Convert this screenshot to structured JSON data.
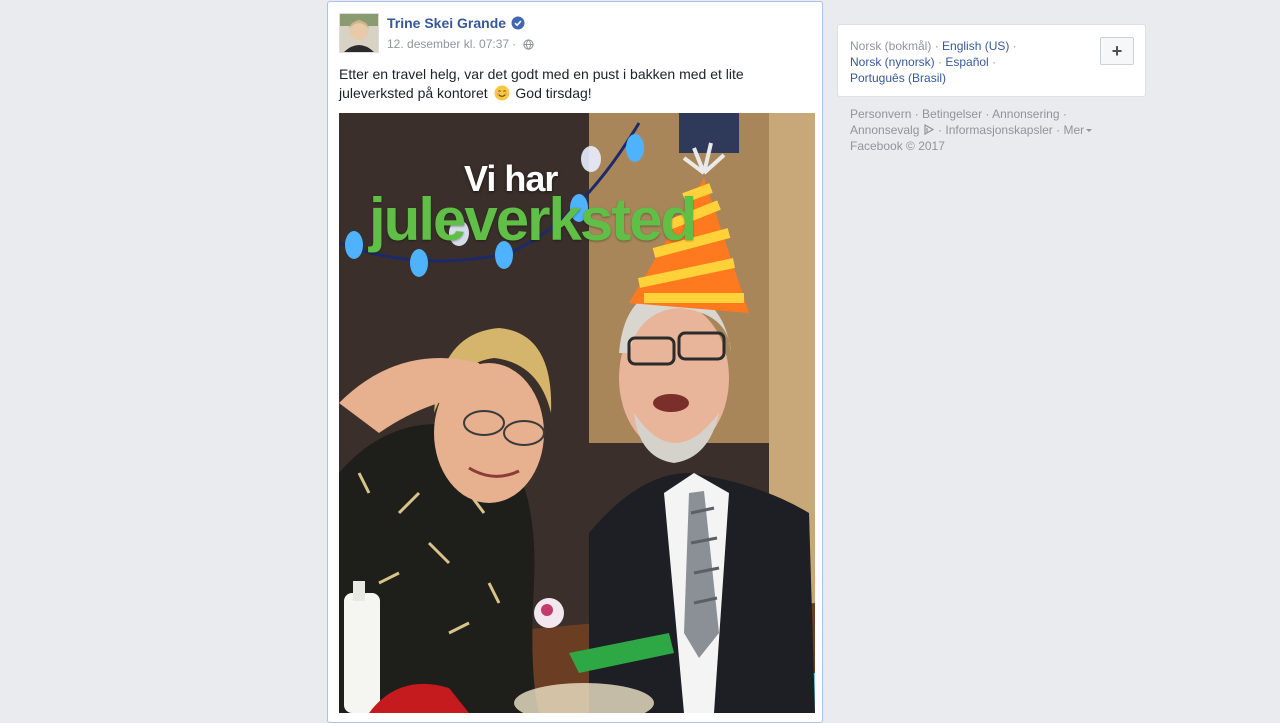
{
  "post": {
    "author": "Trine Skei Grande",
    "timestamp": "12. desember kl. 07:37",
    "separator": "·",
    "text_before_emoji": "Etter en travel helg, var det godt med en pust i bakken med et lite juleverksted på kontoret",
    "text_after_emoji": "God tirsdag!",
    "photo_text_line1": "Vi har",
    "photo_text_line2": "juleverksted",
    "icons": [
      "verified-badge-icon",
      "globe-icon",
      "smiling-emoji"
    ]
  },
  "languages": {
    "current": "Norsk (bokmål)",
    "options": [
      "English (US)",
      "Norsk (nynorsk)",
      "Español",
      "Português (Brasil)"
    ],
    "add_button": "+"
  },
  "footer": {
    "links": [
      "Personvern",
      "Betingelser",
      "Annonsering",
      "Annonsevalg",
      "Informasjonskapsler",
      "Mer"
    ],
    "copyright": "Facebook © 2017"
  },
  "colors": {
    "link": "#365899",
    "muted": "#90949c",
    "background": "#e9ebee",
    "verified": "#4267b2"
  }
}
